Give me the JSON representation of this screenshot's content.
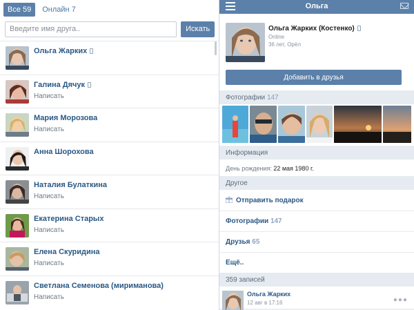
{
  "tabs": [
    {
      "label": "Все 59",
      "active": true
    },
    {
      "label": "Онлайн 7",
      "active": false
    }
  ],
  "search": {
    "placeholder": "Введите имя друга..",
    "button": "Искать"
  },
  "friends": [
    {
      "name": "Ольга Жарких",
      "write": "",
      "mobile": true
    },
    {
      "name": "Галина Дячук",
      "write": "Написать",
      "mobile": true
    },
    {
      "name": "Мария Морозова",
      "write": "Написать",
      "mobile": false
    },
    {
      "name": "Анна Шорохова",
      "write": "",
      "mobile": false
    },
    {
      "name": "Наталия Булаткина",
      "write": "Написать",
      "mobile": false
    },
    {
      "name": "Екатерина Старых",
      "write": "Написать",
      "mobile": false
    },
    {
      "name": "Елена Скуридина",
      "write": "Написать",
      "mobile": false
    },
    {
      "name": "Светлана Семенова (мириманова)",
      "write": "Написать",
      "mobile": false
    }
  ],
  "header": {
    "title": "Ольга"
  },
  "profile": {
    "name": "Ольга Жарких (Костенко)",
    "status": "Online",
    "meta": "36 лет, Орёл",
    "add_button": "Добавить в друзья"
  },
  "photos_section": {
    "label": "Фотографии",
    "count": "147"
  },
  "info_section": {
    "label": "Информация",
    "birthday_label": "День рождения:",
    "birthday_value": "22 мая 1980 г."
  },
  "other_section": {
    "label": "Другое"
  },
  "menu": {
    "gift": "Отправить подарок",
    "photos_label": "Фотографии",
    "photos_count": "147",
    "friends_label": "Друзья",
    "friends_count": "65",
    "more": "Ещё.."
  },
  "posts_section": {
    "label": "359 записей"
  },
  "post": {
    "author": "Ольга Жарких",
    "time": "12 авг в 17:16"
  },
  "colors": {
    "accent": "#5b80aa",
    "link": "#2a5885",
    "section_bg": "#e5ebf1"
  }
}
